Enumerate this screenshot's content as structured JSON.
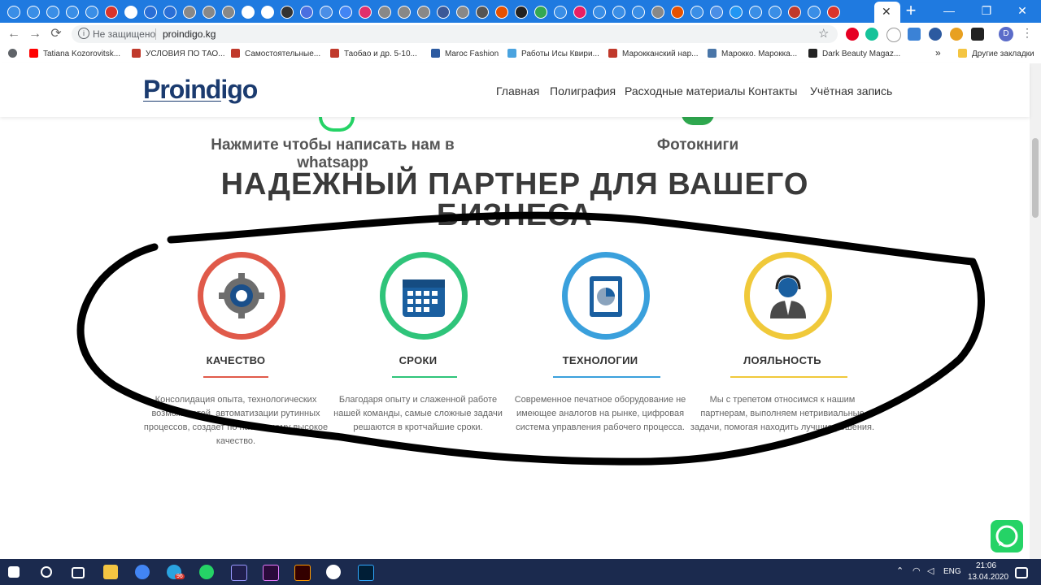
{
  "browser": {
    "tabs_count": 44,
    "new_tab_label": "+",
    "active_tab_close": "✕",
    "window_controls": [
      "—",
      "❐",
      "✕"
    ],
    "nav": {
      "back": "←",
      "forward": "→",
      "reload": "⟳"
    },
    "security_label": "Не защищено",
    "url": "proindigo.kg",
    "bookmarks": [
      "Tatiana Kozorovitsk...",
      "УСЛОВИЯ ПО ТАО...",
      "Самостоятельные...",
      "Таобао и др. 5-10...",
      "Maroc Fashion",
      "Работы Исы Квири...",
      "Марокканский нар...",
      "Марокко. Марокка...",
      "Dark Beauty Magaz..."
    ],
    "bookmarks_more": "»",
    "other_bookmarks": "Другие закладки",
    "profile_initial": "D"
  },
  "site": {
    "logo": {
      "name": "Proindigo"
    },
    "menu": [
      "Главная",
      "Полиграфия",
      "Расходные материалы",
      "Контакты",
      "Учётная запись"
    ],
    "whatsapp_cta": "Нажмите чтобы написать нам в whatsapp",
    "photobooks": "Фотокниги",
    "section_title_line1": "НАДЕЖНЫЙ ПАРТНЕР ДЛЯ ВАШЕГО",
    "section_title_line2": "БИЗНЕСА",
    "features": [
      {
        "title": "КАЧЕСТВО",
        "color": "#e05a4a",
        "icon": "gear-icon",
        "text": "Консолидация опыта, технологических возможностей, автоматизации рутинных процессов, создает по настоящему высокое качество."
      },
      {
        "title": "СРОКИ",
        "color": "#2fc47a",
        "icon": "calendar-icon",
        "text": "Благодаря опыту и слаженной работе нашей команды, самые сложные задачи решаются в кротчайшие сроки."
      },
      {
        "title": "ТЕХНОЛОГИИ",
        "color": "#3aa0dc",
        "icon": "chart-monitor-icon",
        "text": "Современное печатное оборудование не имеющее аналогов на рынке, цифровая система управления рабочего процесса."
      },
      {
        "title": "ЛОЯЛЬНОСТЬ",
        "color": "#f0c93a",
        "icon": "support-agent-icon",
        "text": "Мы с трепетом относимся к нашим партнерам, выполняем нетривиальные задачи, помогая находить лучшие решения."
      }
    ]
  },
  "taskbar": {
    "language": "ENG",
    "time": "21:06",
    "date": "13.04.2020",
    "badge": "96"
  }
}
